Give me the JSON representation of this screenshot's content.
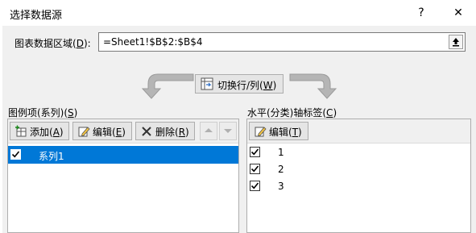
{
  "dialog": {
    "title": "选择数据源",
    "help": "?",
    "close": "✕"
  },
  "range": {
    "label": "图表数据区域(",
    "label_key": "D",
    "label_end": "):",
    "value": "=Sheet1!$B$2:$B$4"
  },
  "switch": {
    "label": "切换行/列(",
    "label_key": "W",
    "label_end": ")"
  },
  "legend": {
    "title": "图例项(系列)(",
    "title_key": "S",
    "title_end": ")",
    "add_label": "添加(",
    "add_key": "A",
    "add_end": ")",
    "edit_label": "编辑(",
    "edit_key": "E",
    "edit_end": ")",
    "delete_label": "删除(",
    "delete_key": "R",
    "delete_end": ")",
    "series": [
      {
        "label": "系列1",
        "checked": true,
        "selected": true
      }
    ]
  },
  "axis": {
    "title": "水平(分类)轴标签(",
    "title_key": "C",
    "title_end": ")",
    "edit_label": "编辑(",
    "edit_key": "T",
    "edit_end": ")",
    "items": [
      {
        "label": "1",
        "checked": true
      },
      {
        "label": "2",
        "checked": true
      },
      {
        "label": "3",
        "checked": true
      }
    ]
  },
  "colors": {
    "selection": "#0078d7",
    "arrow_gray": "#a9a9a9"
  }
}
